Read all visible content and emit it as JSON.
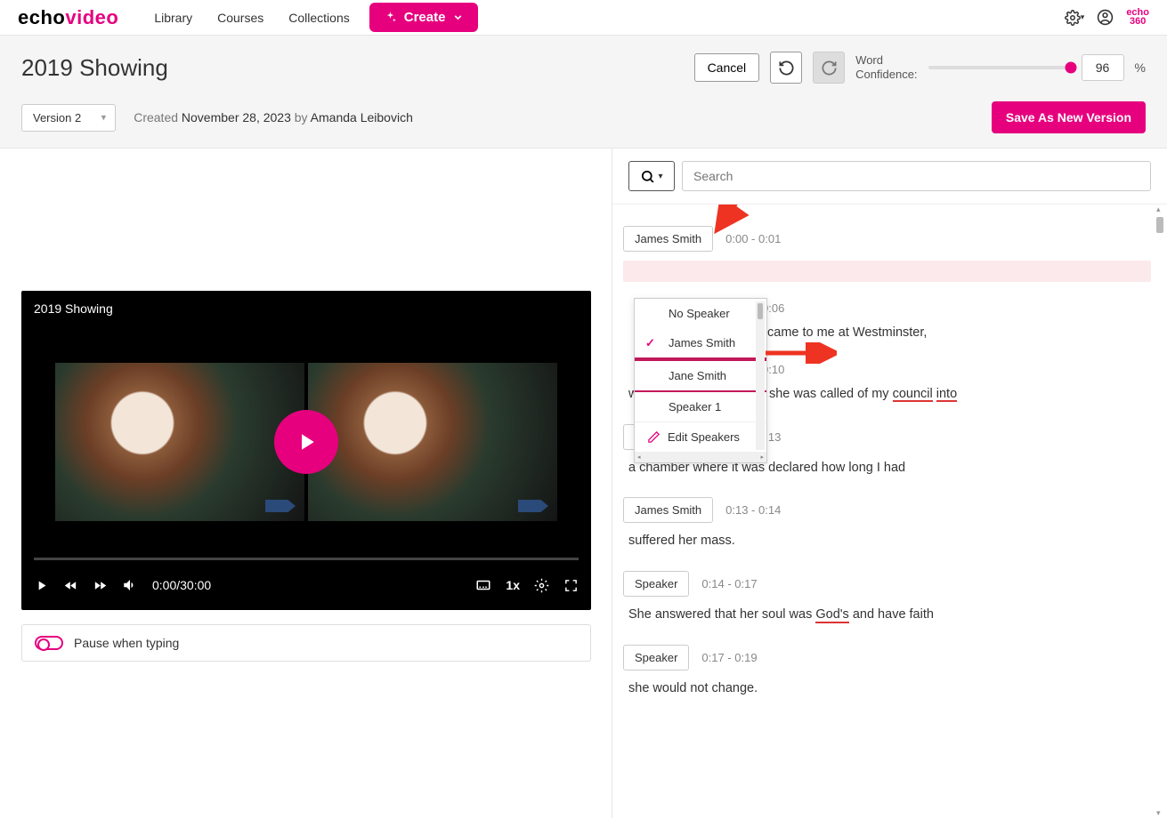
{
  "topbar": {
    "logo_part1": "echo",
    "logo_part2": "video",
    "nav": {
      "library": "Library",
      "courses": "Courses",
      "collections": "Collections"
    },
    "create_label": "Create",
    "brand_small_1": "echo",
    "brand_small_2": "360"
  },
  "header": {
    "title": "2019 Showing",
    "cancel": "Cancel",
    "word_conf_label_1": "Word",
    "word_conf_label_2": "Confidence:",
    "pct_value": "96",
    "pct_sign": "%",
    "version_label": "Version 2",
    "created_prefix": "Created ",
    "created_date": "November 28, 2023",
    "by_prefix": " by ",
    "created_by": "Amanda Leibovich",
    "save_label": "Save As New Version"
  },
  "player": {
    "title": "2019 Showing",
    "time": "0:00/30:00",
    "rate": "1x"
  },
  "pause_toggle_label": "Pause when typing",
  "search": {
    "placeholder": "Search"
  },
  "dropdown": {
    "no_speaker": "No Speaker",
    "opt1": "James Smith",
    "opt2": "Jane Smith",
    "opt3": "Speaker 1",
    "edit": "Edit Speakers"
  },
  "segments": [
    {
      "speaker": "James Smith",
      "time": "0:00 - 0:01",
      "text_hidden": ""
    },
    {
      "speaker_hidden": true,
      "time": "0:06",
      "text": " came to me at Westminster,"
    },
    {
      "time_suffix": "0:10",
      "text": "where, after salutations, she was called of my ",
      "u1": "council",
      "u2": "into"
    },
    {
      "speaker": "James Smith",
      "time": "0:10 - 0:13",
      "text": "a chamber where it was declared how long I had"
    },
    {
      "speaker": "James Smith",
      "time": "0:13 - 0:14",
      "text": "suffered her mass."
    },
    {
      "speaker": "Speaker",
      "time": "0:14 - 0:17",
      "text": "She answered that her soul was ",
      "u1": "God's",
      "tail": " and have faith"
    },
    {
      "speaker": "Speaker",
      "time": "0:17 - 0:19",
      "text": "she would not change."
    }
  ]
}
